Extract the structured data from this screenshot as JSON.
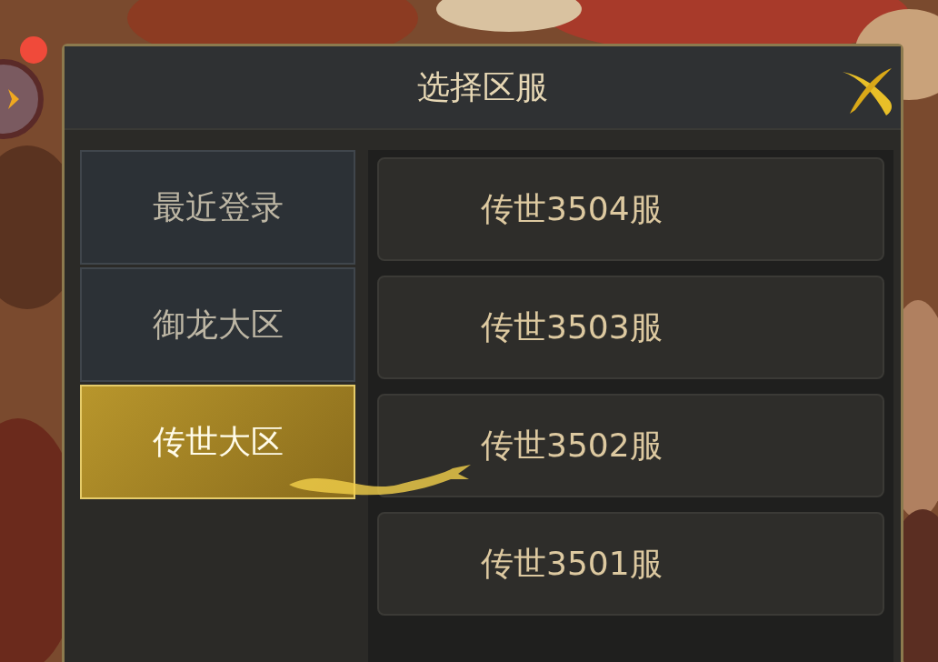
{
  "side_button": {
    "has_badge": true
  },
  "dialog": {
    "title": "选择区服"
  },
  "regions": [
    {
      "label": "最近登录",
      "selected": false
    },
    {
      "label": "御龙大区",
      "selected": false
    },
    {
      "label": "传世大区",
      "selected": true
    }
  ],
  "servers": [
    {
      "label": "传世3504服"
    },
    {
      "label": "传世3503服"
    },
    {
      "label": "传世3502服"
    },
    {
      "label": "传世3501服"
    }
  ]
}
